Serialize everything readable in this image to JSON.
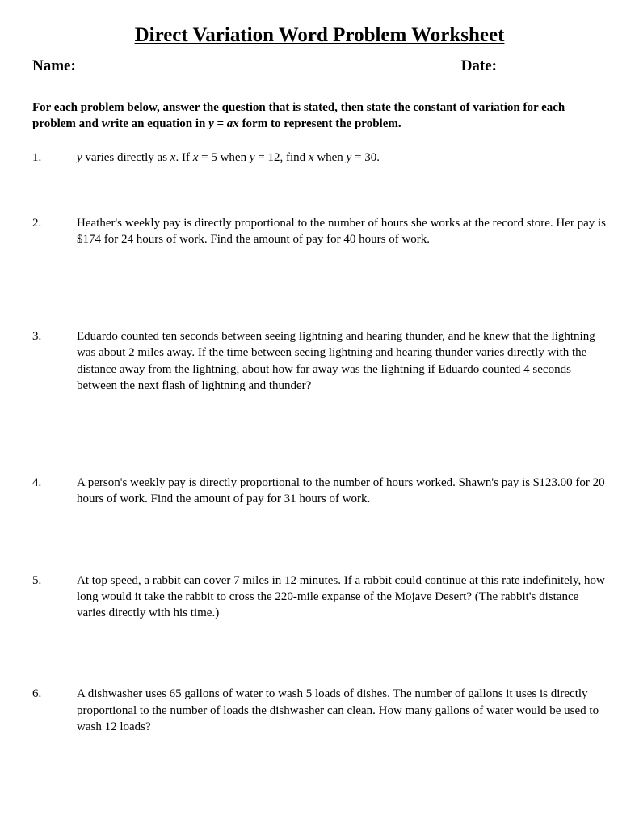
{
  "title": "Direct Variation Word Problem Worksheet",
  "header": {
    "name_label": "Name:",
    "date_label": "Date:"
  },
  "instructions": {
    "part1": "For each problem below, answer the question that is stated, then state the constant of variation for each problem and write an equation in ",
    "equation": "y = ax",
    "part2": " form to represent the problem."
  },
  "problems": [
    {
      "number": "1.",
      "prefix_italic_y": "y",
      "text1": " varies directly as ",
      "italic_x": "x",
      "text2": ". If ",
      "italic_x2": "x",
      "text3": " = 5 when ",
      "italic_y2": "y",
      "text4": " = 12, find ",
      "italic_x3": "x",
      "text5": " when ",
      "italic_y3": "y",
      "text6": " = 30."
    },
    {
      "number": "2.",
      "text": "Heather's weekly pay is directly proportional to the number of hours she works at the record store. Her pay is $174 for 24 hours of work. Find the amount of pay for 40 hours of work."
    },
    {
      "number": "3.",
      "text": "Eduardo counted ten seconds between seeing lightning and hearing thunder, and he knew that the lightning was about 2 miles away. If the time between seeing lightning and hearing thunder varies directly with the distance away from the lightning, about how far away was the lightning if Eduardo counted 4 seconds between the next flash of lightning and thunder?"
    },
    {
      "number": "4.",
      "text": "A person's weekly pay is directly proportional to the number of hours worked. Shawn's pay is $123.00 for 20 hours of work. Find the amount of pay for 31 hours of work."
    },
    {
      "number": "5.",
      "text": "At top speed, a rabbit can cover 7 miles in 12 minutes. If a rabbit could continue at this rate indefinitely, how long would it take the rabbit to cross the 220-mile expanse of the Mojave Desert? (The rabbit's distance varies directly with his time.)"
    },
    {
      "number": "6.",
      "text": "A dishwasher uses 65 gallons of water to wash 5 loads of dishes. The number of gallons it uses is directly proportional to the number of loads the dishwasher can clean. How many gallons of water would be used to wash 12 loads?"
    }
  ]
}
